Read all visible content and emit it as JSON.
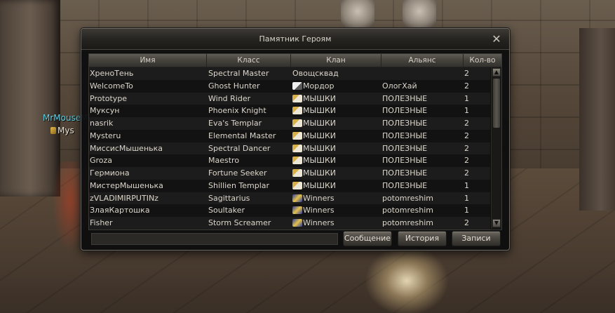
{
  "window": {
    "title": "Памятник Героям",
    "close_symbol": "✕"
  },
  "ingame": {
    "player_name": "MrMouseM",
    "player_title": "Mys"
  },
  "table": {
    "columns": [
      "Имя",
      "Класс",
      "Клан",
      "Альянс",
      "Кол-во"
    ],
    "rows": [
      {
        "name": "ХреноТень",
        "class": "Spectral Master",
        "clan": "Овощсквад",
        "clan_crest": "",
        "alliance": "",
        "count": "2"
      },
      {
        "name": "WelcomeTo",
        "class": "Ghost Hunter",
        "clan": "Мордор",
        "clan_crest": "mordor",
        "alliance": "ОлогХай",
        "count": "2"
      },
      {
        "name": "Prototype",
        "class": "Wind Rider",
        "clan": "МЫШКИ",
        "clan_crest": "mouse",
        "alliance": "ПОЛЕЗНЫЕ",
        "count": "1"
      },
      {
        "name": "Муксун",
        "class": "Phoenix Knight",
        "clan": "МЫШКИ",
        "clan_crest": "mouse",
        "alliance": "ПОЛЕЗНЫЕ",
        "count": "1"
      },
      {
        "name": "nasrik",
        "class": "Eva's Templar",
        "clan": "МЫШКИ",
        "clan_crest": "mouse",
        "alliance": "ПОЛЕЗНЫЕ",
        "count": "2"
      },
      {
        "name": "Mysteru",
        "class": "Elemental Master",
        "clan": "МЫШКИ",
        "clan_crest": "mouse",
        "alliance": "ПОЛЕЗНЫЕ",
        "count": "2"
      },
      {
        "name": "МиссисМышенька",
        "class": "Spectral Dancer",
        "clan": "МЫШКИ",
        "clan_crest": "mouse",
        "alliance": "ПОЛЕЗНЫЕ",
        "count": "2"
      },
      {
        "name": "Groza",
        "class": "Maestro",
        "clan": "МЫШКИ",
        "clan_crest": "mouse",
        "alliance": "ПОЛЕЗНЫЕ",
        "count": "2"
      },
      {
        "name": "Гермиона",
        "class": "Fortune Seeker",
        "clan": "МЫШКИ",
        "clan_crest": "mouse",
        "alliance": "ПОЛЕЗНЫЕ",
        "count": "2"
      },
      {
        "name": "МистерМышенька",
        "class": "Shillien Templar",
        "clan": "МЫШКИ",
        "clan_crest": "mouse",
        "alliance": "ПОЛЕЗНЫЕ",
        "count": "1"
      },
      {
        "name": "zVLADIMIRPUTINz",
        "class": "Sagittarius",
        "clan": "Winners",
        "clan_crest": "winners",
        "alliance": "potomreshim",
        "count": "1"
      },
      {
        "name": "ЗлаяКартошка",
        "class": "Soultaker",
        "clan": "Winners",
        "clan_crest": "winners",
        "alliance": "potomreshim",
        "count": "1"
      },
      {
        "name": "Fisher",
        "class": "Storm Screamer",
        "clan": "Winners",
        "clan_crest": "winners",
        "alliance": "potomreshim",
        "count": "2"
      }
    ]
  },
  "scrollbar": {
    "up_symbol": "▲",
    "down_symbol": "▼"
  },
  "buttons": {
    "message": "Сообщение",
    "history": "История",
    "records": "Записи"
  },
  "message_input": {
    "value": ""
  }
}
